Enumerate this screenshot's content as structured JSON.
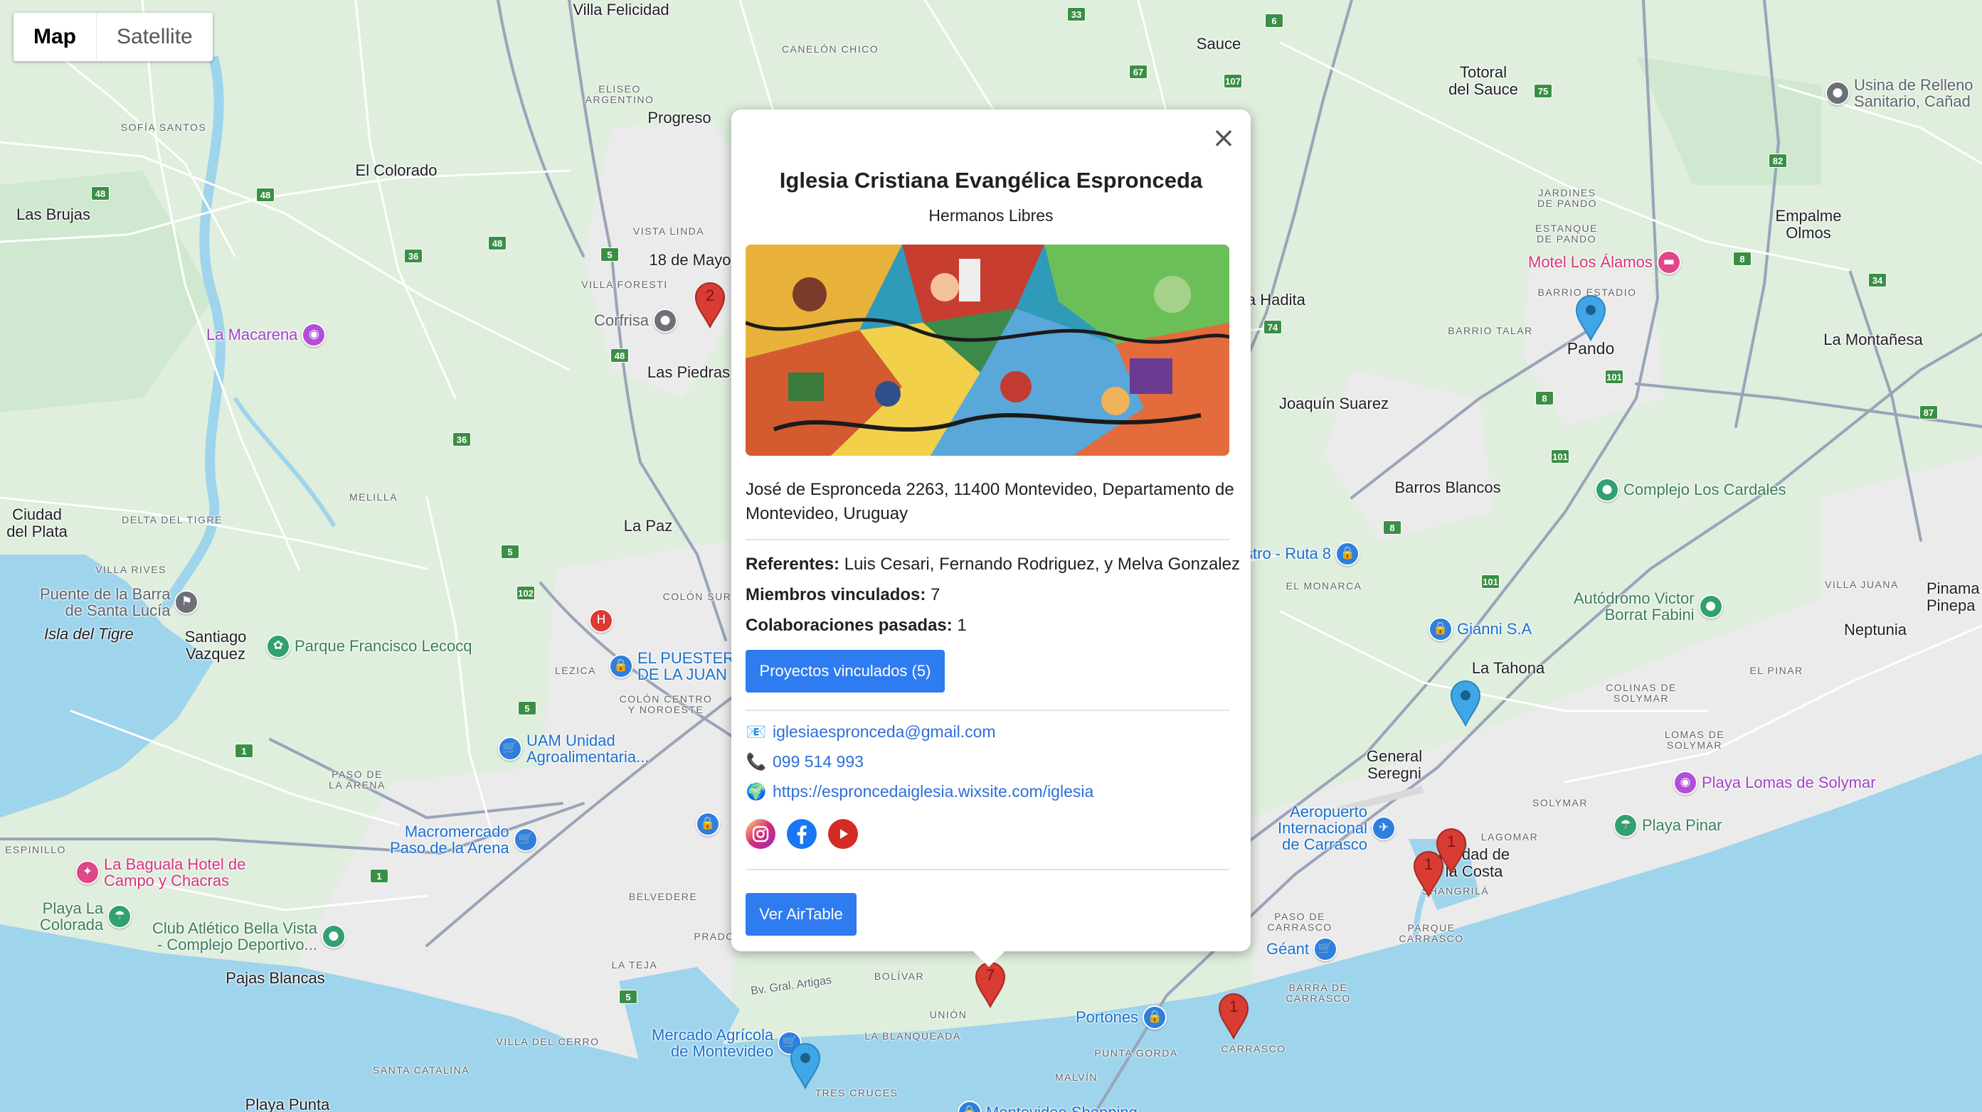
{
  "map_type": {
    "map_label": "Map",
    "satellite_label": "Satellite",
    "active": "Map"
  },
  "places": {
    "villa_felicidad": "Villa Felicidad",
    "canelon_chico": "CANELÓN CHICO",
    "sauce": "Sauce",
    "totoral": "Totoral\ndel Sauce",
    "eliseo": "ELISEO\nARGENTINO",
    "progreso": "Progreso",
    "sofia_santos": "SOFÍA SANTOS",
    "el_colorado": "El Colorado",
    "las_brujas": "Las Brujas",
    "vista_linda": "VISTA LINDA",
    "mayo": "18 de Mayo",
    "villa_foresti": "VILLA FORESTI",
    "las_piedras": "Las Piedras",
    "jardines": "JARDINES\nDE PANDO",
    "estanque": "ESTANQUE\nDE PANDO",
    "empalme": "Empalme\nOlmos",
    "barrio_estadio": "BARRIO ESTADIO",
    "barrio_talar": "BARRIO TALAR",
    "pando": "Pando",
    "la_montanesa": "La Montañesa",
    "la_hadita": "la Hadita",
    "joaquin_suarez": "Joaquín Suarez",
    "barros_blancos": "Barros Blancos",
    "melilla": "MELILLA",
    "ciudad_plata": "Ciudad\ndel Plata",
    "delta_tigre": "DELTA DEL TIGRE",
    "la_paz": "La Paz",
    "villa_rives": "VILLA RIVES",
    "el_monarca": "EL MONARCA",
    "villa_juana": "VILLA JUANA",
    "pinamar": "Pinama\nPinepa",
    "neptunia": "Neptunia",
    "isla_tigre": "Isla del Tigre",
    "santiago_vazquez": "Santiago\nVazquez",
    "colon_sur": "COLÓN SUR",
    "lezica": "LEZICA",
    "colon_centro": "COLÓN CENTRO\nY NOROESTE",
    "la_tahona": "La Tahona",
    "el_pinar": "EL PINAR",
    "colinas": "COLINAS DE\nSOLYMAR",
    "lomas_solymar": "LOMAS DE\nSOLYMAR",
    "general_seregni": "General\nSeregni",
    "paso_arena": "PASO DE\nLA ARENA",
    "solymar": "SOLYMAR",
    "lagomar": "LAGOMAR",
    "ciudad_costa": "Ciudad de\nla Costa",
    "shangrila": "SHANGRILÁ",
    "espinillo": "ESPINILLO",
    "paso_carrasco": "PASO DE\nCARRASCO",
    "parque_carrasco": "PARQUE\nCARRASCO",
    "belvedere": "BELVEDERE",
    "prado": "PRADO",
    "bolivar": "BOLÍVAR",
    "la_teja": "LA TEJA",
    "artigas": "Bv. Gral. Artigas",
    "union": "UNIÓN",
    "barra_carrasco": "BARRA DE\nCARRASCO",
    "carrasco": "CARRASCO",
    "villa_cerro": "VILLA DEL CERRO",
    "la_blanqueada": "LA BLANQUEADA",
    "punta_gorda": "PUNTA GORDA",
    "pajas_blancas": "Pajas Blancas",
    "santa_catalina": "SANTA CATALINA",
    "tres_cruces": "TRES CRUCES",
    "malvin": "MALVÍN",
    "playa_punta": "Playa Punta"
  },
  "pois": {
    "usina": "Usina de Relleno\nSanitario, Cañad",
    "motel": "Motel Los Álamos",
    "macarena": "La Macarena",
    "corfrisa": "Corfrisa",
    "complejo_cardales": "Complejo Los Cardales",
    "rutax": "stro - Ruta 8",
    "gianni": "Gianni S.A",
    "autodromo": "Autódromo Victor\nBorrat Fabini",
    "puente_barra": "Puente de la Barra\nde Santa Lucía",
    "parque_lecocq": "Parque Francisco Lecocq",
    "el_puestero": "EL PUESTERO\nDE LA JUAN",
    "uam": "UAM Unidad\nAgroalimentaria...",
    "macromercado": "Macromercado\nPaso de la Arena",
    "aeropuerto": "Aeropuerto\nInternacional\nde Carrasco",
    "playa_lomas": "Playa Lomas de Solymar",
    "playa_pinar": "Playa Pinar",
    "la_baguala": "La Baguala Hotel de\nCampo y Chacras",
    "playa_colorada": "Playa La\nColorada",
    "club_bella_vista": "Club Atlético Bella Vista\n- Complejo Deportivo...",
    "geant": "Géant",
    "portones": "Portones",
    "mercado_agricola": "Mercado Agrícola\nde Montevideo",
    "mvd_shopping": "Montevideo Shopping"
  },
  "route_shields": [
    "33",
    "6",
    "67",
    "107",
    "75",
    "82",
    "48",
    "48",
    "48",
    "36",
    "5",
    "48",
    "36",
    "5",
    "74",
    "8",
    "101",
    "8",
    "101",
    "34",
    "87",
    "8",
    "101",
    "102",
    "5",
    "1",
    "1",
    "1",
    "5"
  ],
  "markers": [
    {
      "label": "2",
      "color": "#d93c33"
    },
    {
      "label": "",
      "color": "#3fa7e6"
    },
    {
      "label": "",
      "color": "#3fa7e6"
    },
    {
      "label": "1",
      "color": "#d93c33"
    },
    {
      "label": "1",
      "color": "#d93c33"
    },
    {
      "label": "7",
      "color": "#d93c33"
    },
    {
      "label": "1",
      "color": "#d93c33"
    },
    {
      "label": "",
      "color": "#3fa7e6"
    }
  ],
  "popup": {
    "close_icon": "×",
    "title": "Iglesia Cristiana Evangélica Espronceda",
    "subtitle": "Hermanos Libres",
    "address": "José de Espronceda 2263, 11400 Montevideo, Departamento de Montevideo, Uruguay",
    "referentes_label": "Referentes:",
    "referentes_value": " Luis Cesari, Fernando Rodriguez, y Melva Gonzalez",
    "miembros_label": "Miembros vinculados:",
    "miembros_value": " 7",
    "colab_label": "Colaboraciones pasadas:",
    "colab_value": " 1",
    "proyectos_button": "Proyectos vinculados (5)",
    "email_icon": "📧",
    "email": "iglesiaespronceda@gmail.com",
    "phone_icon": "📞",
    "phone": "099 514 993",
    "web_icon": "🌍",
    "website": "https://esproncedaiglesia.wixsite.com/iglesia",
    "social": [
      "instagram-icon",
      "facebook-icon",
      "youtube-icon"
    ],
    "airtable_button": "Ver AirTable"
  },
  "colors": {
    "water": "#9ed4ec",
    "land": "#dfeedd",
    "urban": "#ececec",
    "road_major": "#9aa4b8",
    "road_minor": "#ffffff",
    "accent": "#2f7bf0"
  }
}
